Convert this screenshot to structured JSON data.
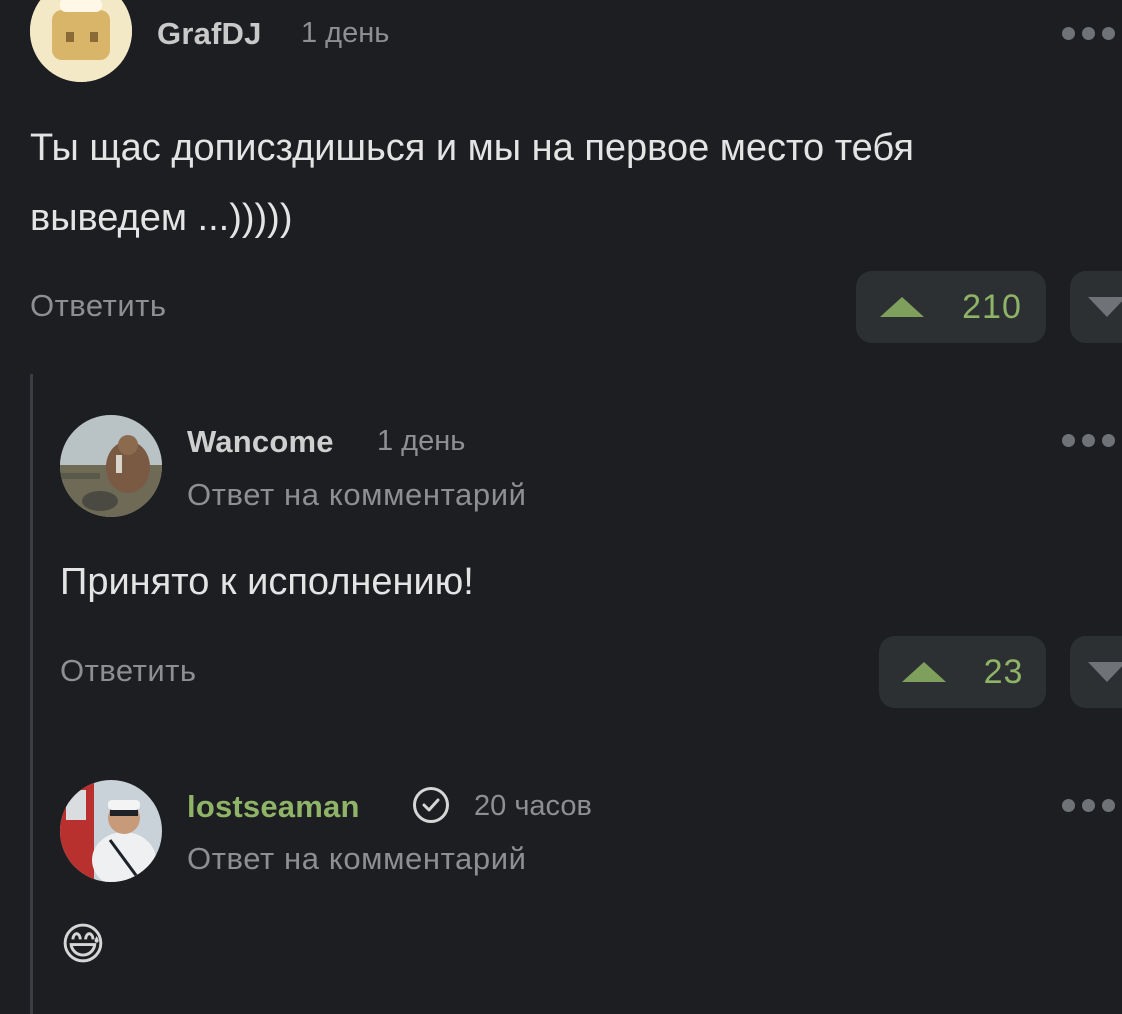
{
  "comments": [
    {
      "author": "GrafDJ",
      "time": "1 день",
      "text_line1": "Ты щас дописздишься и мы на первое место тебя",
      "text_line2": "выведем ...)))))",
      "reply_label": "Ответить",
      "votes": "210"
    },
    {
      "author": "Wancome",
      "time": "1 день",
      "subtitle": "Ответ на комментарий",
      "text": "Принято к исполнению!",
      "reply_label": "Ответить",
      "votes": "23"
    },
    {
      "author": "lostseaman",
      "time": "20 часов",
      "subtitle": "Ответ на комментарий",
      "text": "😅"
    }
  ],
  "colors": {
    "background": "#1c1e21",
    "accent_green": "#8fb468",
    "muted": "#8d8f93"
  },
  "icons": [
    "more-icon",
    "upvote-icon",
    "downvote-icon",
    "verified-icon"
  ]
}
